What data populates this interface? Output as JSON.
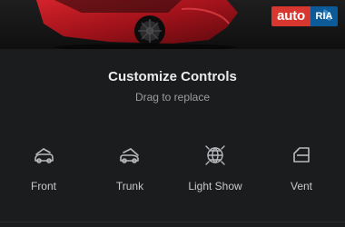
{
  "watermark": {
    "part1": "auto",
    "part2": "RIA"
  },
  "panel": {
    "title": "Customize Controls",
    "subtitle": "Drag to replace"
  },
  "controls": [
    {
      "label": "Front",
      "icon": "front-trunk-icon"
    },
    {
      "label": "Trunk",
      "icon": "rear-trunk-icon"
    },
    {
      "label": "Light Show",
      "icon": "light-show-icon"
    },
    {
      "label": "Vent",
      "icon": "window-vent-icon"
    }
  ],
  "colors": {
    "background": "#1b1c1e",
    "title": "#ececec",
    "subtitle": "#9d9ea1",
    "icon": "#b9babd",
    "car_red": "#b3141c"
  }
}
